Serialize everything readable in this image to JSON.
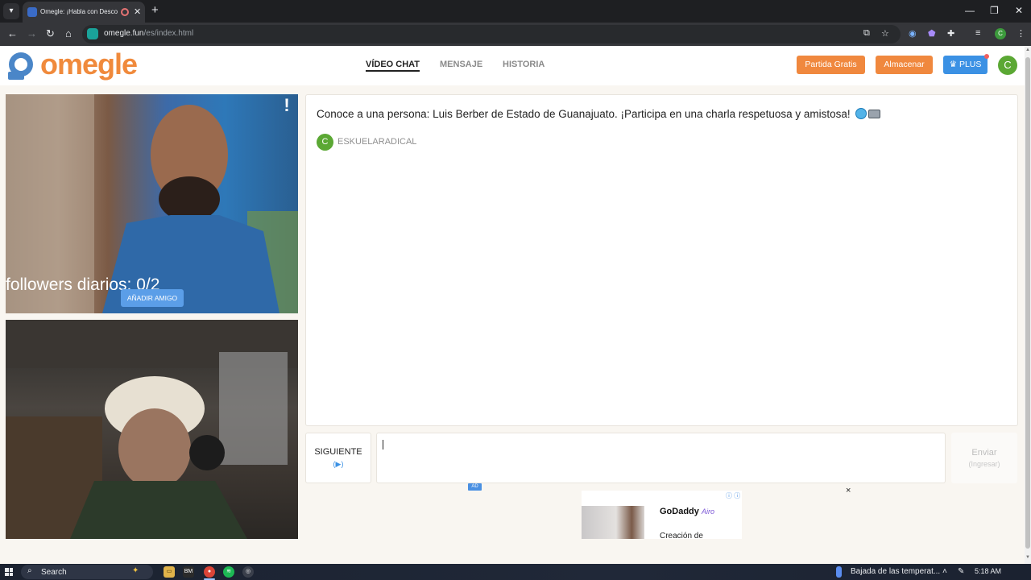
{
  "browser": {
    "tab_title": "Omegle: ¡Habla con Descon",
    "tab_close": "✕",
    "new_tab": "+",
    "url_domain": "omegle.fun",
    "url_path": "/es/index.html",
    "window_controls": {
      "minimize": "—",
      "restore": "❐",
      "close": "✕"
    },
    "profile_initial": "C"
  },
  "site": {
    "logo_text": "omegle",
    "nav": {
      "video_chat": "VÍDEO CHAT",
      "messages": "MENSAJE",
      "history": "HISTORIA"
    },
    "buttons": {
      "free_game": "Partida Gratis",
      "store": "Almacenar",
      "plus": "PLUS"
    },
    "user_initial": "C"
  },
  "video": {
    "report": "!",
    "followers": "followers diarios: 0/2",
    "add_friend": "AÑADIR AMIGO"
  },
  "chat": {
    "intro": "Conoce a una persona: Luis Berber de Estado de Guanajuato. ¡Participa en una charla respetuosa y amistosa!",
    "user_initial": "C",
    "username": "ESKUELARADICAL",
    "next_label": "SIGUIENTE",
    "next_hint": "(▶)",
    "send_label": "Enviar",
    "send_hint": "(Ingresar)"
  },
  "ad": {
    "badge": "AD",
    "info": "ⓘ ⓘ",
    "brand": "GoDaddy",
    "brand_suffix": "Airo",
    "text": "Creación de",
    "close": "×"
  },
  "taskbar": {
    "search": "Search",
    "bm_label": "BM",
    "weather": "Bajada de las temperat...",
    "time": "5:18 AM"
  },
  "colors": {
    "brand_orange": "#f08a3c",
    "plus_blue": "#3b91e4",
    "avatar_green": "#5ba834"
  }
}
